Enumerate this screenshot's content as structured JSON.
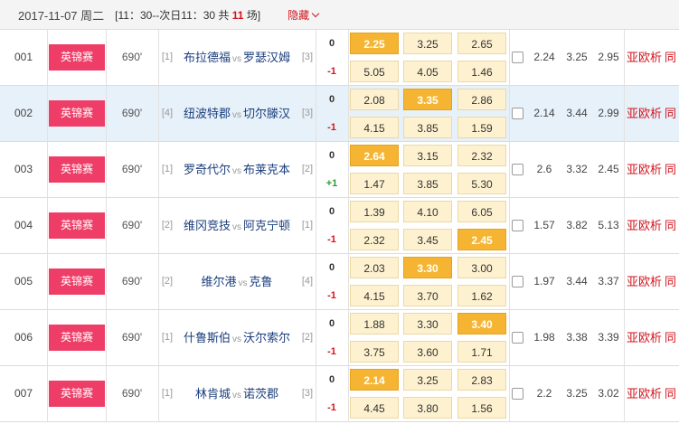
{
  "header": {
    "date": "2017-11-07 周二",
    "range_prefix": "[11：30--次日11：30 共 ",
    "count": "11",
    "range_suffix": " 场]",
    "hide_label": "隐藏"
  },
  "links": [
    "亚",
    "欧",
    "析",
    "同"
  ],
  "matches": [
    {
      "num": "001",
      "league": "英锦赛",
      "minute": "690'",
      "home_rank": "[1]",
      "home": "布拉德福",
      "vs": "vs",
      "away": "罗瑟汉姆",
      "away_rank": "[3]",
      "handicap": "0",
      "hc2": "-1",
      "odds": [
        "2.25",
        "3.25",
        "2.65"
      ],
      "odds2": [
        "5.05",
        "4.05",
        "1.46"
      ],
      "hi1": [
        true,
        false,
        false
      ],
      "hi2": [
        false,
        false,
        false
      ],
      "avg": [
        "2.24",
        "3.25",
        "2.95"
      ]
    },
    {
      "num": "002",
      "league": "英锦赛",
      "minute": "690'",
      "home_rank": "[4]",
      "home": "纽波特郡",
      "vs": "vs",
      "away": "切尔滕汉",
      "away_rank": "[3]",
      "handicap": "0",
      "hc2": "-1",
      "odds": [
        "2.08",
        "3.35",
        "2.86"
      ],
      "odds2": [
        "4.15",
        "3.85",
        "1.59"
      ],
      "hi1": [
        false,
        true,
        false
      ],
      "hi2": [
        false,
        false,
        false
      ],
      "avg": [
        "2.14",
        "3.44",
        "2.99"
      ]
    },
    {
      "num": "003",
      "league": "英锦赛",
      "minute": "690'",
      "home_rank": "[1]",
      "home": "罗奇代尔",
      "vs": "vs",
      "away": "布莱克本",
      "away_rank": "[2]",
      "handicap": "0",
      "hc2": "+1",
      "odds": [
        "2.64",
        "3.15",
        "2.32"
      ],
      "odds2": [
        "1.47",
        "3.85",
        "5.30"
      ],
      "hi1": [
        true,
        false,
        false
      ],
      "hi2": [
        false,
        false,
        false
      ],
      "avg": [
        "2.6",
        "3.32",
        "2.45"
      ]
    },
    {
      "num": "004",
      "league": "英锦赛",
      "minute": "690'",
      "home_rank": "[2]",
      "home": "维冈竞技",
      "vs": "vs",
      "away": "阿克宁顿",
      "away_rank": "[1]",
      "handicap": "0",
      "hc2": "-1",
      "odds": [
        "1.39",
        "4.10",
        "6.05"
      ],
      "odds2": [
        "2.32",
        "3.45",
        "2.45"
      ],
      "hi1": [
        false,
        false,
        false
      ],
      "hi2": [
        false,
        false,
        true
      ],
      "avg": [
        "1.57",
        "3.82",
        "5.13"
      ]
    },
    {
      "num": "005",
      "league": "英锦赛",
      "minute": "690'",
      "home_rank": "[2]",
      "home": "维尔港",
      "vs": "vs",
      "away": "克鲁",
      "away_rank": "[4]",
      "handicap": "0",
      "hc2": "-1",
      "odds": [
        "2.03",
        "3.30",
        "3.00"
      ],
      "odds2": [
        "4.15",
        "3.70",
        "1.62"
      ],
      "hi1": [
        false,
        true,
        false
      ],
      "hi2": [
        false,
        false,
        false
      ],
      "avg": [
        "1.97",
        "3.44",
        "3.37"
      ]
    },
    {
      "num": "006",
      "league": "英锦赛",
      "minute": "690'",
      "home_rank": "[1]",
      "home": "什鲁斯伯",
      "vs": "vs",
      "away": "沃尔索尔",
      "away_rank": "[2]",
      "handicap": "0",
      "hc2": "-1",
      "odds": [
        "1.88",
        "3.30",
        "3.40"
      ],
      "odds2": [
        "3.75",
        "3.60",
        "1.71"
      ],
      "hi1": [
        false,
        false,
        true
      ],
      "hi2": [
        false,
        false,
        false
      ],
      "avg": [
        "1.98",
        "3.38",
        "3.39"
      ]
    },
    {
      "num": "007",
      "league": "英锦赛",
      "minute": "690'",
      "home_rank": "[1]",
      "home": "林肯城",
      "vs": "vs",
      "away": "诺茨郡",
      "away_rank": "[3]",
      "handicap": "0",
      "hc2": "-1",
      "odds": [
        "2.14",
        "3.25",
        "2.83"
      ],
      "odds2": [
        "4.45",
        "3.80",
        "1.56"
      ],
      "hi1": [
        true,
        false,
        false
      ],
      "hi2": [
        false,
        false,
        false
      ],
      "avg": [
        "2.2",
        "3.25",
        "3.02"
      ]
    }
  ]
}
